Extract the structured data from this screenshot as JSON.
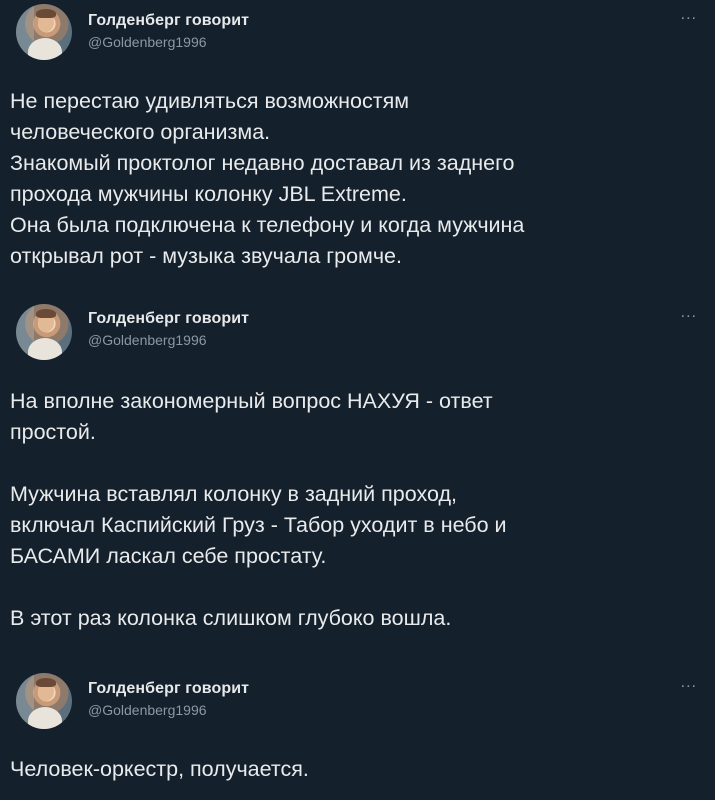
{
  "tweets": [
    {
      "author": "Голденберг говорит",
      "handle": "@Goldenberg1996",
      "more": "...",
      "text": "Не перестаю удивляться возможностям\nчеловеческого организма.\nЗнакомый проктолог недавно доставал из заднего\nпрохода мужчины колонку JBL Extreme.\nОна была подключена к телефону и когда мужчина\nоткрывал рот - музыка звучала громче."
    },
    {
      "author": "Голденберг говорит",
      "handle": "@Goldenberg1996",
      "more": "...",
      "text": "На вполне закономерный вопрос НАХУЯ - ответ\nпростой.\n\nМужчина вставлял колонку в задний проход,\nвключал Каспийский Груз - Табор уходит в небо и\nБАСАМИ ласкал себе простату.\n\nВ этот раз колонка слишком глубоко вошла."
    },
    {
      "author": "Голденберг говорит",
      "handle": "@Goldenberg1996",
      "more": "...",
      "text": "Человек-оркестр, получается."
    }
  ]
}
